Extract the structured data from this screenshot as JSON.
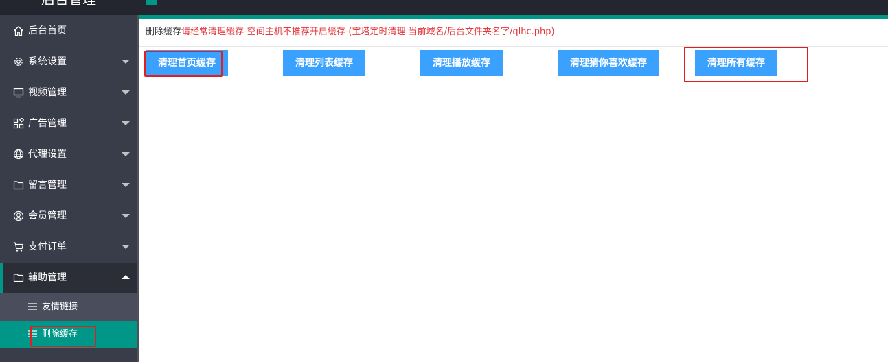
{
  "header": {
    "app_title": "后台管理"
  },
  "sidebar": {
    "items": [
      {
        "label": "后台首页",
        "icon": "home-icon"
      },
      {
        "label": "系统设置",
        "icon": "gear-icon"
      },
      {
        "label": "视频管理",
        "icon": "monitor-icon"
      },
      {
        "label": "广告管理",
        "icon": "apps-icon"
      },
      {
        "label": "代理设置",
        "icon": "globe-icon"
      },
      {
        "label": "留言管理",
        "icon": "folder-icon"
      },
      {
        "label": "会员管理",
        "icon": "user-icon"
      },
      {
        "label": "支付订单",
        "icon": "cart-icon"
      },
      {
        "label": "辅助管理",
        "icon": "folder-icon"
      }
    ],
    "sub_items": [
      {
        "label": "友情链接",
        "icon": "menu-icon"
      },
      {
        "label": "删除缓存",
        "icon": "menu-icon"
      }
    ]
  },
  "main": {
    "notice_prefix": "删除缓存",
    "notice_warning": "请经常清理缓存-空间主机不推荐开启缓存-(宝塔定时清理 当前域名/后台文件夹名字/qlhc.php)",
    "buttons": [
      "清理首页缓存",
      "清理列表缓存",
      "清理播放缓存",
      "清理猜你喜欢缓存",
      "清理所有缓存"
    ]
  },
  "colors": {
    "accent": "#009688",
    "button": "#3aa1ff",
    "sidebar": "#393d49",
    "warning_text": "#e4393c",
    "highlight": "#e02020"
  }
}
